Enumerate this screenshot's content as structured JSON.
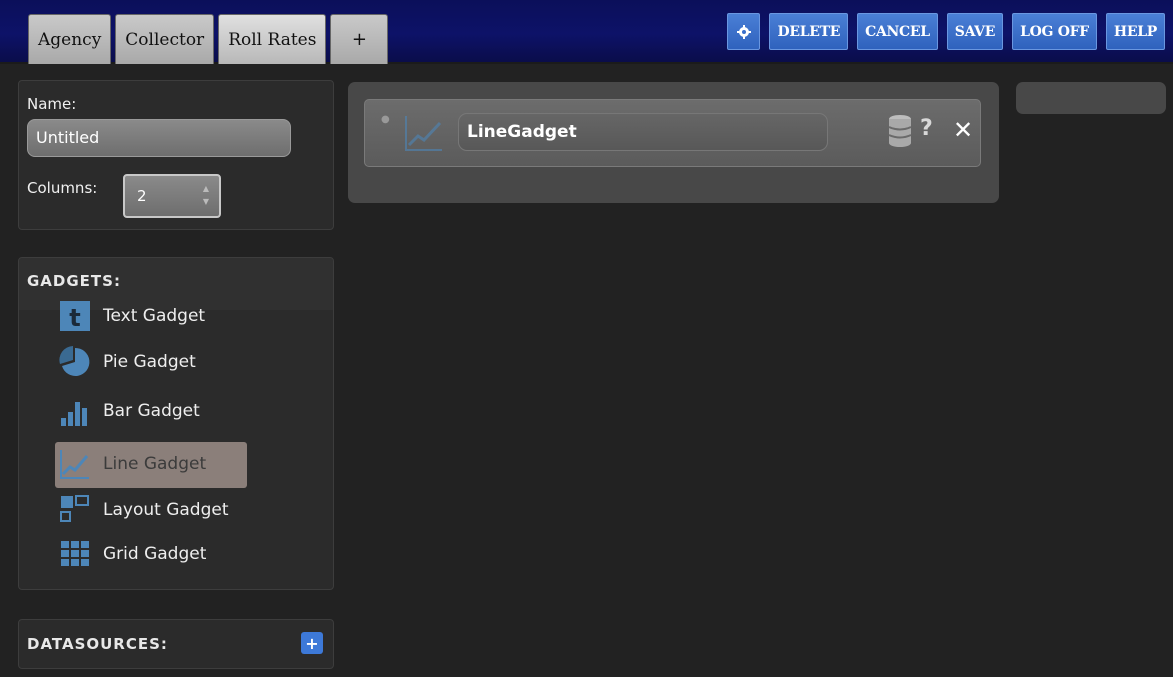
{
  "tabs": [
    {
      "label": "Agency"
    },
    {
      "label": "Collector"
    },
    {
      "label": "Roll Rates"
    },
    {
      "label": "+"
    }
  ],
  "actions": {
    "delete": "DELETE",
    "cancel": "CANCEL",
    "save": "SAVE",
    "logoff": "LOG OFF",
    "help": "HELP"
  },
  "settings": {
    "name_label": "Name:",
    "name_value": "Untitled",
    "columns_label": "Columns:",
    "columns_value": "2"
  },
  "gadgets": {
    "heading": "GADGETS:",
    "items": [
      {
        "label": "Text Gadget",
        "icon": "text-gadget-icon"
      },
      {
        "label": "Pie Gadget",
        "icon": "pie-gadget-icon"
      },
      {
        "label": "Bar Gadget",
        "icon": "bar-gadget-icon"
      },
      {
        "label": "Line Gadget",
        "icon": "line-gadget-icon"
      },
      {
        "label": "Layout Gadget",
        "icon": "layout-gadget-icon"
      },
      {
        "label": "Grid Gadget",
        "icon": "grid-gadget-icon"
      }
    ]
  },
  "datasources": {
    "heading": "DATASOURCES:",
    "add": "+"
  },
  "canvas": {
    "gadget_title": "LineGadget",
    "help": "?",
    "close": "✕"
  },
  "colors": {
    "topbar": "#0d1268",
    "button_blue": "#3a6fcc",
    "panel_bg": "#2b2b2b",
    "selected_item": "#9c8e88"
  }
}
